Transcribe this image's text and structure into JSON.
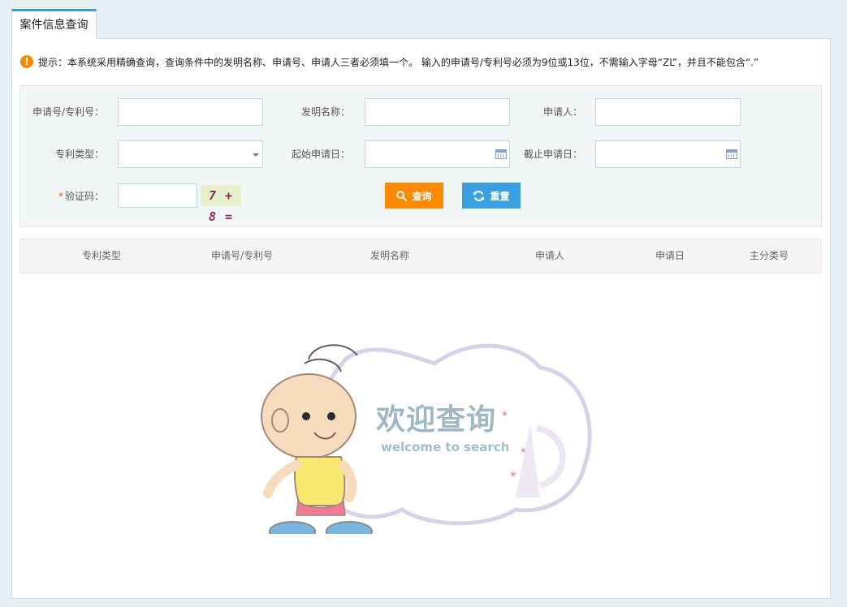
{
  "tab": {
    "label": "案件信息查询"
  },
  "tip": {
    "icon": "warning-icon",
    "text": "提示：本系统采用精确查询，查询条件中的发明名称、申请号、申请人三者必须填一个。 输入的申请号/专利号必须为9位或13位，不需输入字母“ZL”，并且不能包含“.”"
  },
  "form": {
    "app_number_label": "申请号/专利号：",
    "invention_name_label": "发明名称：",
    "applicant_label": "申请人：",
    "patent_type_label": "专利类型：",
    "start_date_label": "起始申请日：",
    "end_date_label": "截止申请日：",
    "captcha_required_mark": "*",
    "captcha_label": "验证码：",
    "captcha_text": "7 + 8 =",
    "app_number_value": "",
    "invention_name_value": "",
    "applicant_value": "",
    "patent_type_value": "",
    "start_date_value": "",
    "end_date_value": "",
    "captcha_value": ""
  },
  "buttons": {
    "search_label": "查询",
    "reset_label": "重置"
  },
  "table": {
    "columns": [
      "专利类型",
      "申请号/专利号",
      "发明名称",
      "申请人",
      "申请日",
      "主分类号"
    ]
  },
  "welcome": {
    "title": "欢迎查询",
    "subtitle": "welcome to search"
  },
  "colors": {
    "accent": "#3a9bd9",
    "search_button": "#ff8a00",
    "reset_button": "#3aa0df",
    "warning": "#f08a00"
  }
}
